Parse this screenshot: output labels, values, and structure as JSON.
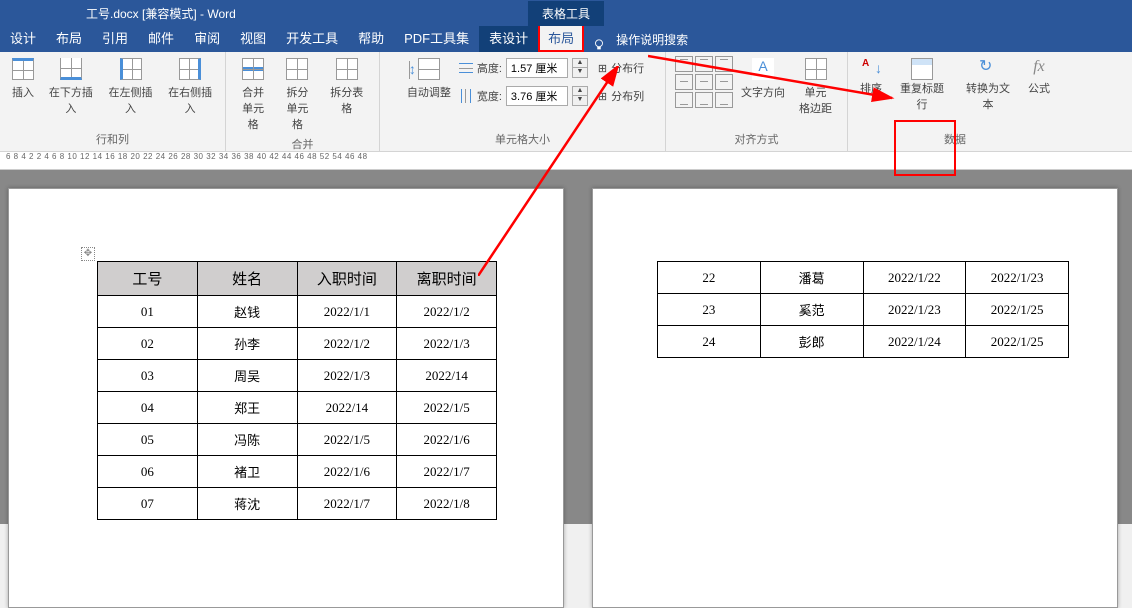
{
  "title": "工号.docx [兼容模式] - Word",
  "context_tab": "表格工具",
  "tabs": [
    "设计",
    "布局",
    "引用",
    "邮件",
    "审阅",
    "视图",
    "开发工具",
    "帮助",
    "PDF工具集",
    "表设计",
    "布局"
  ],
  "search_hint": "操作说明搜索",
  "ribbon": {
    "rows_cols": {
      "label": "行和列",
      "btns": [
        "插入",
        "在下方插入",
        "在左侧插入",
        "在右侧插入"
      ]
    },
    "merge": {
      "label": "合并",
      "btns": [
        "合并\n单元格",
        "拆分\n单元格",
        "拆分表格"
      ]
    },
    "cell_size": {
      "label": "单元格大小",
      "autofit": "自动调整",
      "height_lbl": "高度:",
      "height_val": "1.57 厘米",
      "width_lbl": "宽度:",
      "width_val": "3.76 厘米",
      "dist_row": "分布行",
      "dist_col": "分布列"
    },
    "alignment": {
      "label": "对齐方式",
      "textdir": "文字方向",
      "margins": "单元\n格边距"
    },
    "data": {
      "label": "数据",
      "sort": "排序",
      "repeat": "重复标题行",
      "convert": "转换为文本",
      "formula": "公式"
    }
  },
  "ruler_text": "6  8  4  2    2  4  6  8  10 12 14 16 18    20 22 24 26 28 30 32 34 36 38    40 42 44 46    48 52 54 46 48",
  "table1": {
    "headers": [
      "工号",
      "姓名",
      "入职时间",
      "离职时间"
    ],
    "rows": [
      [
        "01",
        "赵钱",
        "2022/1/1",
        "2022/1/2"
      ],
      [
        "02",
        "孙李",
        "2022/1/2",
        "2022/1/3"
      ],
      [
        "03",
        "周吴",
        "2022/1/3",
        "2022/14"
      ],
      [
        "04",
        "郑王",
        "2022/14",
        "2022/1/5"
      ],
      [
        "05",
        "冯陈",
        "2022/1/5",
        "2022/1/6"
      ],
      [
        "06",
        "褚卫",
        "2022/1/6",
        "2022/1/7"
      ],
      [
        "07",
        "蒋沈",
        "2022/1/7",
        "2022/1/8"
      ]
    ]
  },
  "table2": {
    "rows": [
      [
        "22",
        "潘葛",
        "2022/1/22",
        "2022/1/23"
      ],
      [
        "23",
        "奚范",
        "2022/1/23",
        "2022/1/25"
      ],
      [
        "24",
        "彭郎",
        "2022/1/24",
        "2022/1/25"
      ]
    ]
  },
  "chart_data": null
}
